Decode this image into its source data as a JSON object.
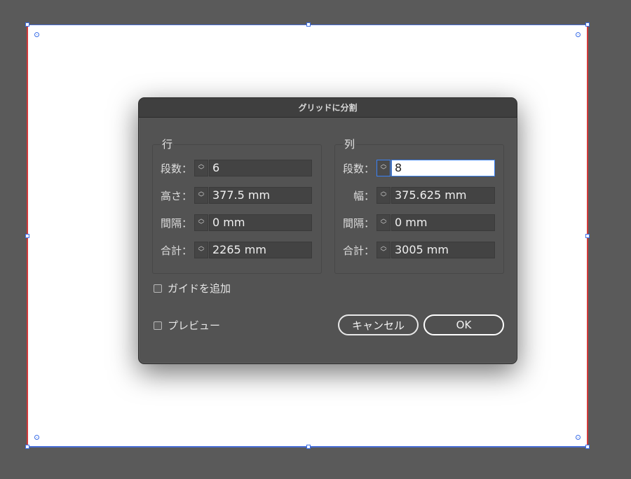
{
  "dialog": {
    "title": "グリッドに分割",
    "rows": {
      "title": "行",
      "count_label": "段数：",
      "count_value": "6",
      "height_label": "高さ：",
      "height_value": "377.5 mm",
      "gutter_label": "間隔：",
      "gutter_value": "0 mm",
      "total_label": "合計：",
      "total_value": "2265 mm"
    },
    "columns": {
      "title": "列",
      "count_label": "段数：",
      "count_value": "8",
      "width_label": "幅：",
      "width_value": "375.625 mm",
      "gutter_label": "間隔：",
      "gutter_value": "0 mm",
      "total_label": "合計：",
      "total_value": "3005 mm"
    },
    "add_guides_label": "ガイドを追加",
    "preview_label": "プレビュー",
    "cancel_label": "キャンセル",
    "ok_label": "OK"
  },
  "icons": {
    "spinner": "up-down-chevron-icon",
    "checkbox": "checkbox-unchecked"
  },
  "colors": {
    "canvas": "#5a5a5a",
    "dialog": "#535353",
    "active_border": "#3b82f6",
    "artboard_outline": "#d23a3a",
    "selection": "#3a6ee8"
  }
}
